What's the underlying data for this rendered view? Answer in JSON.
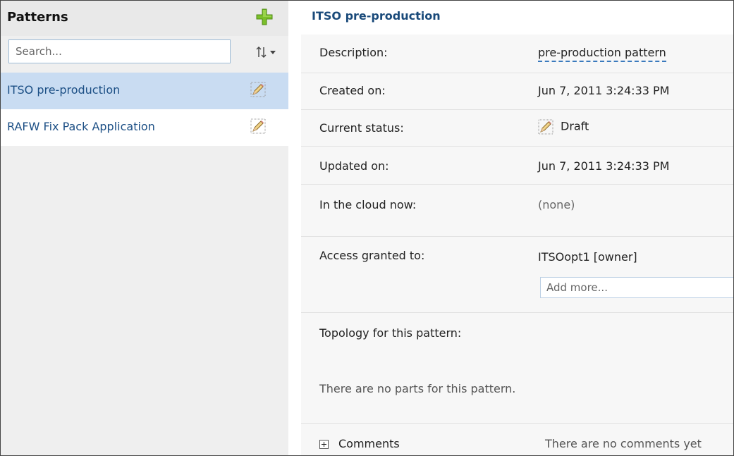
{
  "patterns_panel": {
    "title": "Patterns",
    "search_placeholder": "Search...",
    "items": [
      {
        "label": "ITSO pre-production",
        "selected": true
      },
      {
        "label": "RAFW Fix Pack Application",
        "selected": false
      }
    ]
  },
  "detail": {
    "title": "ITSO pre-production",
    "description_label": "Description:",
    "description_value": "pre-production pattern",
    "created_label": "Created on:",
    "created_value": "Jun 7, 2011 3:24:33 PM",
    "status_label": "Current status:",
    "status_value": "Draft",
    "updated_label": "Updated on:",
    "updated_value": "Jun 7, 2011 3:24:33 PM",
    "cloud_label": "In the cloud now:",
    "cloud_value": "(none)",
    "access_label": "Access granted to:",
    "access_value": "ITSOopt1 [owner]",
    "add_more_placeholder": "Add more...",
    "topology_label": "Topology for this pattern:",
    "no_parts_text": "There are no parts for this pattern.",
    "comments_label": "Comments",
    "no_comments_text": "There are no comments yet"
  },
  "colors": {
    "selected_row": "#c9dcf2",
    "link_text": "#1c4f85",
    "title_text": "#1a4a7a",
    "add_icon": "#7bbf2a"
  },
  "icons": {
    "add": "plus-icon",
    "sort": "sort-icon",
    "edit": "pencil-icon",
    "expand": "expand-plus-icon"
  }
}
